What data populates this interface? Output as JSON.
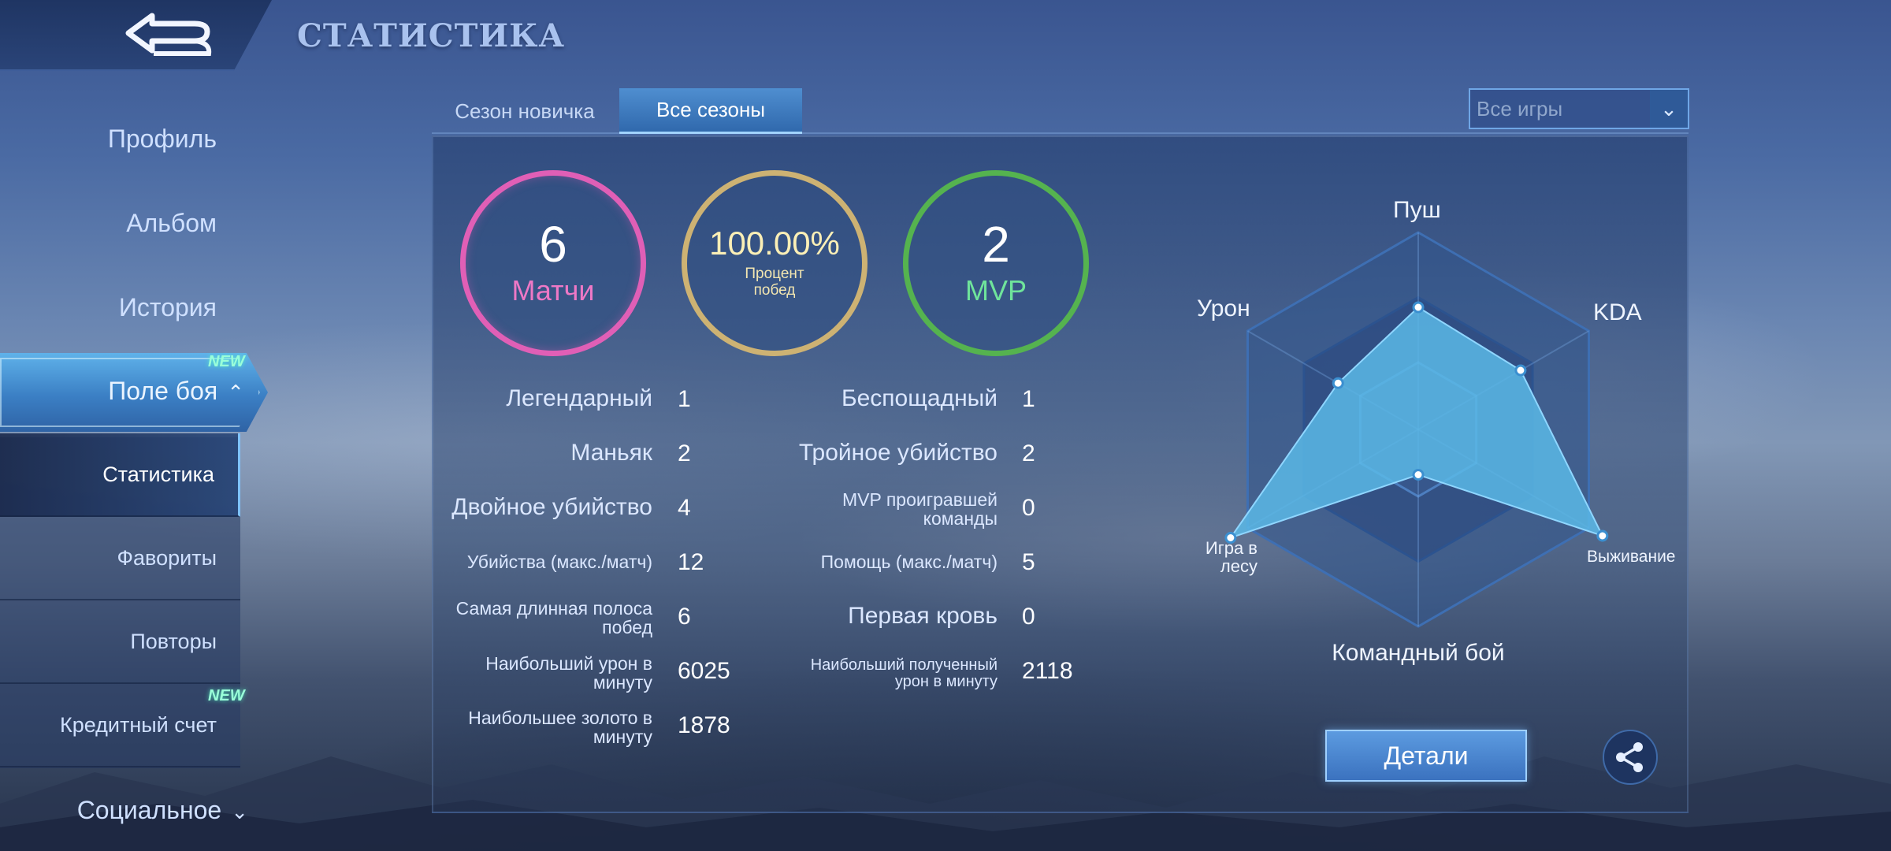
{
  "header": {
    "title": "СТАТИСТИКА",
    "back_icon": "back-arrow-icon"
  },
  "sidebar": {
    "items": [
      {
        "label": "Профиль"
      },
      {
        "label": "Альбом"
      },
      {
        "label": "История"
      },
      {
        "label": "Поле боя",
        "badge": "NEW"
      }
    ],
    "subitems": [
      {
        "label": "Статистика"
      },
      {
        "label": "Фавориты"
      },
      {
        "label": "Повторы"
      },
      {
        "label": "Кредитный счет",
        "badge": "NEW"
      }
    ],
    "social": {
      "label": "Социальное"
    }
  },
  "tabs": [
    {
      "label": "Сезон новичка"
    },
    {
      "label": "Все сезоны"
    }
  ],
  "filter": {
    "value": "Все игры"
  },
  "summary": {
    "matches": {
      "value": "6",
      "label": "Матчи",
      "color": "#e05fb6"
    },
    "winrate": {
      "value": "100.00%",
      "label": "Процент побед",
      "color": "#cdb273"
    },
    "mvp": {
      "value": "2",
      "label": "MVP",
      "color": "#55b34f"
    }
  },
  "stats_left": [
    {
      "label": "Легендарный",
      "value": "1"
    },
    {
      "label": "Маньяк",
      "value": "2"
    },
    {
      "label": "Двойное убийство",
      "value": "4"
    },
    {
      "label": "Убийства (макс./матч)",
      "value": "12"
    },
    {
      "label": "Самая длинная полоса побед",
      "value": "6"
    },
    {
      "label": "Наибольший урон в минуту",
      "value": "6025"
    },
    {
      "label": "Наибольшее золото в минуту",
      "value": "1878"
    }
  ],
  "stats_right": [
    {
      "label": "Беспощадный",
      "value": "1"
    },
    {
      "label": "Тройное убийство",
      "value": "2"
    },
    {
      "label": "MVP проигравшей команды",
      "value": "0"
    },
    {
      "label": "Помощь (макс./матч)",
      "value": "5"
    },
    {
      "label": "Первая кровь",
      "value": "0"
    },
    {
      "label": "Наибольший полученный урон в минуту",
      "value": "2118"
    }
  ],
  "radar": {
    "labels": {
      "push": "Пуш",
      "kda": "KDA",
      "survival": "Выживание",
      "teamfight": "Командный бой",
      "jungle": "Игра в лесу",
      "damage": "Урон"
    },
    "levels": {
      "push": 0.62,
      "kda": 0.6,
      "survival": 1.08,
      "teamfight": 0.23,
      "jungle": 1.1,
      "damage": 0.47
    },
    "fill_color": "#5bb9e6"
  },
  "buttons": {
    "details": "Детали",
    "share_icon": "share-icon"
  }
}
